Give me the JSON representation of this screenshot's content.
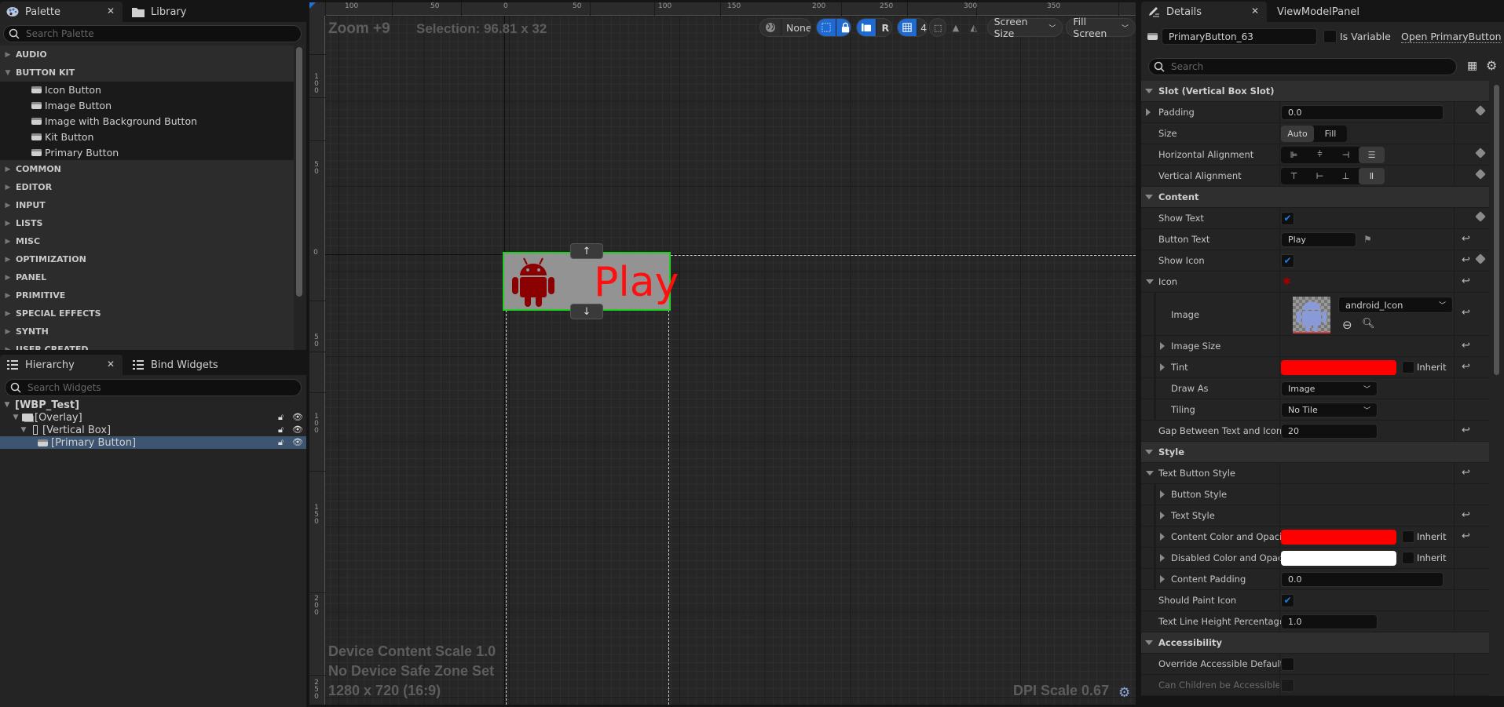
{
  "palette": {
    "tab_label": "Palette",
    "library_tab_label": "Library",
    "search_placeholder": "Search Palette",
    "categories": [
      {
        "label": "AUDIO",
        "expanded": false
      },
      {
        "label": "BUTTON KIT",
        "expanded": true,
        "items": [
          "Icon Button",
          "Image Button",
          "Image with Background Button",
          "Kit Button",
          "Primary Button"
        ]
      },
      {
        "label": "COMMON",
        "expanded": false
      },
      {
        "label": "EDITOR",
        "expanded": false
      },
      {
        "label": "INPUT",
        "expanded": false
      },
      {
        "label": "LISTS",
        "expanded": false
      },
      {
        "label": "MISC",
        "expanded": false
      },
      {
        "label": "OPTIMIZATION",
        "expanded": false
      },
      {
        "label": "PANEL",
        "expanded": false
      },
      {
        "label": "PRIMITIVE",
        "expanded": false
      },
      {
        "label": "SPECIAL EFFECTS",
        "expanded": false
      },
      {
        "label": "SYNTH",
        "expanded": false
      },
      {
        "label": "USER CREATED",
        "expanded": false
      }
    ]
  },
  "hierarchy": {
    "tab_label": "Hierarchy",
    "bind_tab_label": "Bind Widgets",
    "search_placeholder": "Search Widgets",
    "nodes": [
      {
        "label": "[WBP_Test]"
      },
      {
        "label": "[Overlay]"
      },
      {
        "label": "[Vertical Box]"
      },
      {
        "label": "[Primary Button]",
        "selected": true
      }
    ]
  },
  "viewport": {
    "zoom_label": "Zoom +9",
    "selection_label": "Selection: 96.81 x 32",
    "top_ruler": [
      "100",
      "50",
      "0",
      "50",
      "100",
      "150",
      "200",
      "250",
      "300",
      "350"
    ],
    "left_ruler": [
      "100",
      "50",
      "0",
      "50",
      "100",
      "150",
      "200",
      "250"
    ],
    "toolbar": {
      "locale": "None",
      "respect_lock": "R",
      "grid_snap": "4",
      "screen_size": "Screen Size",
      "fill_mode": "Fill Screen"
    },
    "preview_button": {
      "text": "Play",
      "text_color": "#ff1010",
      "icon_color": "#8b0000"
    },
    "info": [
      "Device Content Scale 1.0",
      "No Device Safe Zone Set",
      "1280 x 720 (16:9)"
    ],
    "dpi_label": "DPI Scale 0.67"
  },
  "details": {
    "tab_label": "Details",
    "viewmodel_tab_label": "ViewModelPanel",
    "widget_name": "PrimaryButton_63",
    "is_variable_label": "Is Variable",
    "is_variable": false,
    "open_link": "Open PrimaryButton",
    "search_placeholder": "Search",
    "sections": {
      "slot": "Slot (Vertical Box Slot)",
      "content": "Content",
      "style": "Style",
      "accessibility": "Accessibility"
    },
    "props": {
      "padding": {
        "label": "Padding",
        "value": "0.0"
      },
      "size": {
        "label": "Size",
        "options": [
          "Auto",
          "Fill"
        ],
        "selected": "Auto"
      },
      "h_align": {
        "label": "Horizontal Alignment",
        "selected": "Fill"
      },
      "v_align": {
        "label": "Vertical Alignment",
        "selected": "Fill"
      },
      "show_text": {
        "label": "Show Text",
        "checked": true
      },
      "button_text": {
        "label": "Button Text",
        "value": "Play"
      },
      "show_icon": {
        "label": "Show Icon",
        "checked": true
      },
      "icon": {
        "label": "Icon"
      },
      "image": {
        "label": "Image",
        "asset": "android_Icon"
      },
      "image_size": {
        "label": "Image Size"
      },
      "tint": {
        "label": "Tint",
        "color": "#ff0000",
        "inherit_label": "Inherit"
      },
      "draw_as": {
        "label": "Draw As",
        "value": "Image"
      },
      "tiling": {
        "label": "Tiling",
        "value": "No Tile"
      },
      "gap": {
        "label": "Gap Between Text and Icon",
        "value": "20"
      },
      "text_button_style": {
        "label": "Text Button Style"
      },
      "button_style": {
        "label": "Button Style"
      },
      "text_style": {
        "label": "Text Style"
      },
      "content_color": {
        "label": "Content Color and Opacity",
        "color": "#ff0000",
        "inherit_label": "Inherit"
      },
      "disabled_color": {
        "label": "Disabled Color and Opacity",
        "color": "#ffffff",
        "inherit_label": "Inherit"
      },
      "content_padding": {
        "label": "Content Padding",
        "value": "0.0"
      },
      "should_paint_icon": {
        "label": "Should Paint Icon",
        "checked": true
      },
      "line_height": {
        "label": "Text Line Height Percentage",
        "value": "1.0"
      },
      "override_accessible": {
        "label": "Override Accessible Defaults",
        "checked": false
      },
      "children_accessible": {
        "label": "Can Children be Accessible",
        "checked": false
      }
    }
  }
}
